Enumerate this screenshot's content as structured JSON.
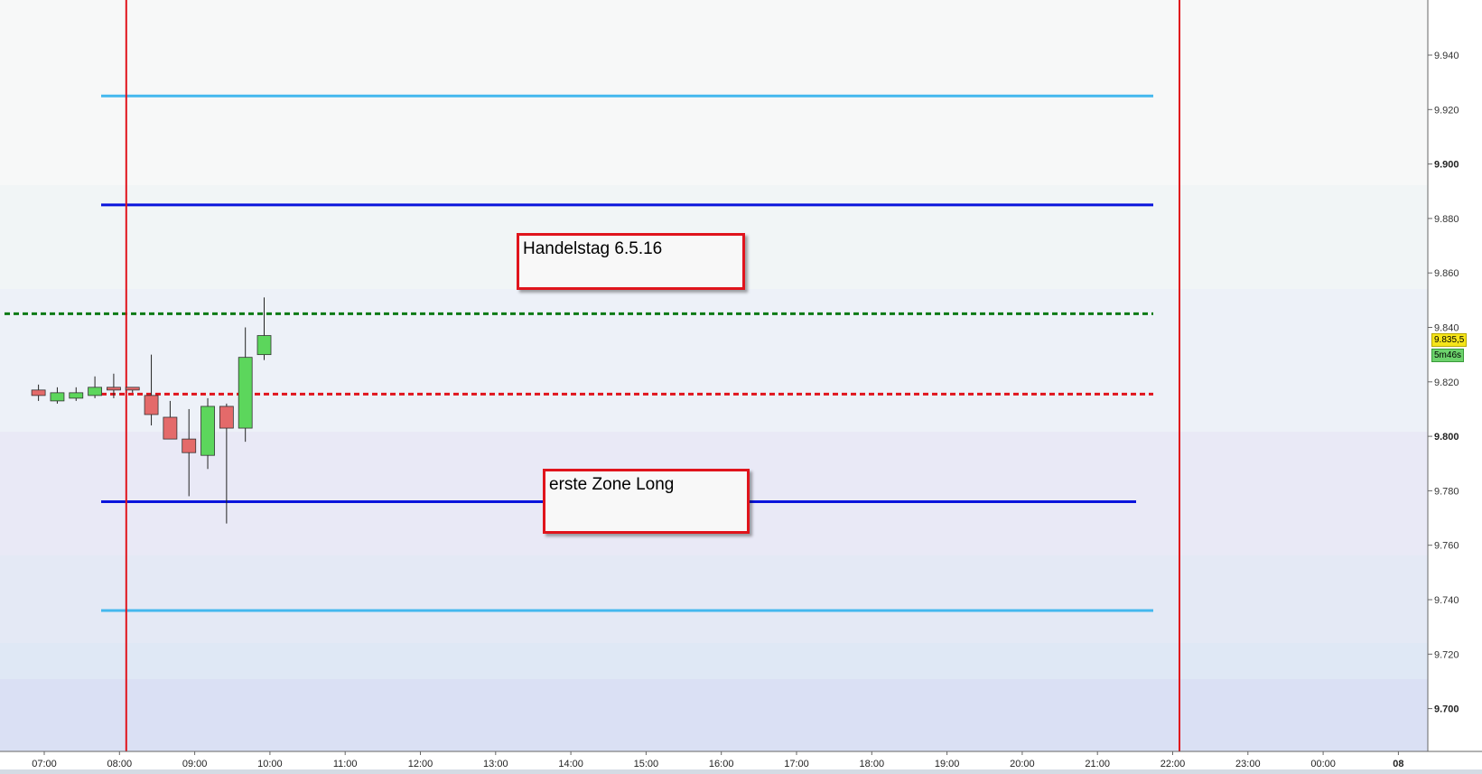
{
  "chart_data": {
    "type": "candlestick",
    "y_range": [
      9687,
      9961
    ],
    "x_range_hours": [
      "06:20",
      "09:00 next day"
    ],
    "y_ticks": [
      "9.940",
      "9.920",
      "9.900",
      "9.880",
      "9.860",
      "9.840",
      "9.820",
      "9.800",
      "9.780",
      "9.760",
      "9.740",
      "9.720",
      "9.700"
    ],
    "y_tick_values": [
      9940,
      9920,
      9900,
      9880,
      9860,
      9840,
      9820,
      9800,
      9780,
      9760,
      9740,
      9720,
      9700
    ],
    "y_major_ticks": [
      "9.900",
      "9.800",
      "9.700"
    ],
    "x_ticks": [
      "07:00",
      "08:00",
      "09:00",
      "10:00",
      "11:00",
      "12:00",
      "13:00",
      "14:00",
      "15:00",
      "16:00",
      "17:00",
      "18:00",
      "19:00",
      "20:00",
      "21:00",
      "22:00",
      "23:00",
      "00:00",
      "08"
    ],
    "x_major_ticks": [
      "08"
    ],
    "candles": [
      {
        "time": "06:35",
        "open": 9817,
        "high": 9819,
        "low": 9813,
        "close": 9815
      },
      {
        "time": "06:50",
        "open": 9813,
        "high": 9818,
        "low": 9812,
        "close": 9816
      },
      {
        "time": "07:05",
        "open": 9814,
        "high": 9818,
        "low": 9813,
        "close": 9816
      },
      {
        "time": "07:20",
        "open": 9815,
        "high": 9822,
        "low": 9814,
        "close": 9818
      },
      {
        "time": "07:35",
        "open": 9818,
        "high": 9823,
        "low": 9814,
        "close": 9817
      },
      {
        "time": "07:50",
        "open": 9818,
        "high": 9818,
        "low": 9816,
        "close": 9817
      },
      {
        "time": "08:05",
        "open": 9815,
        "high": 9830,
        "low": 9804,
        "close": 9808
      },
      {
        "time": "08:20",
        "open": 9807,
        "high": 9813,
        "low": 9799,
        "close": 9799
      },
      {
        "time": "08:35",
        "open": 9799,
        "high": 9810,
        "low": 9778,
        "close": 9794
      },
      {
        "time": "08:50",
        "open": 9793,
        "high": 9814,
        "low": 9788,
        "close": 9811
      },
      {
        "time": "09:05",
        "open": 9811,
        "high": 9812,
        "low": 9768,
        "close": 9803
      },
      {
        "time": "09:20",
        "open": 9803,
        "high": 9840,
        "low": 9798,
        "close": 9829
      },
      {
        "time": "09:35",
        "open": 9830,
        "high": 9851,
        "low": 9828,
        "close": 9837
      }
    ],
    "horizontal_lines": [
      {
        "value": 9925,
        "color": "#44b8ee",
        "style": "solid"
      },
      {
        "value": 9885,
        "color": "#0a14dc",
        "style": "solid"
      },
      {
        "value": 9845,
        "color": "#0a7a14",
        "style": "dashed"
      },
      {
        "value": 9815.5,
        "color": "#e0141c",
        "style": "dashed"
      },
      {
        "value": 9776,
        "color": "#0a14dc",
        "style": "solid"
      },
      {
        "value": 9736,
        "color": "#44b8ee",
        "style": "solid"
      }
    ],
    "vertical_lines": [
      {
        "time": "07:45",
        "color": "#e0141c"
      },
      {
        "time": "21:45",
        "color": "#e0141c"
      }
    ],
    "annotations": [
      {
        "text": "Handelstag 6.5.16"
      },
      {
        "text": "erste Zone Long"
      }
    ],
    "current_price": {
      "label": "9.835,5",
      "value": 9835.5
    },
    "countdown": {
      "label": "5m46s"
    },
    "colors": {
      "up_candle": "#5cd65c",
      "down_candle": "#e46a6a",
      "wick": "#222222"
    }
  }
}
